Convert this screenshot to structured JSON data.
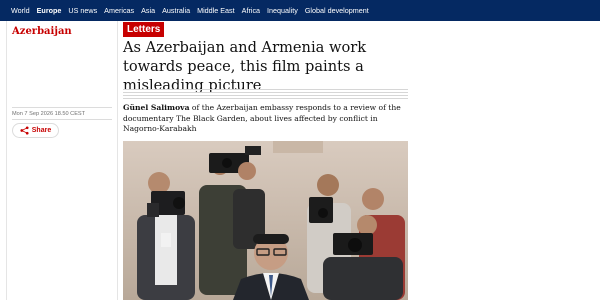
{
  "nav": {
    "items": [
      {
        "label": "World",
        "active": false
      },
      {
        "label": "Europe",
        "active": true
      },
      {
        "label": "US news",
        "active": false
      },
      {
        "label": "Americas",
        "active": false
      },
      {
        "label": "Asia",
        "active": false
      },
      {
        "label": "Australia",
        "active": false
      },
      {
        "label": "Middle East",
        "active": false
      },
      {
        "label": "Africa",
        "active": false
      },
      {
        "label": "Inequality",
        "active": false
      },
      {
        "label": "Global development",
        "active": false
      }
    ]
  },
  "article": {
    "section": "Azerbaijan",
    "kicker": "Letters",
    "headline": "As Azerbaijan and Armenia work towards peace, this film paints a misleading picture",
    "author": "Günel Salimova",
    "standfirst_rest": " of the Azerbaijan embassy responds to a review of the documentary The Black Garden, about lives affected by conflict in Nagorno-Karabakh",
    "dateline": "Mon 7 Sep 2026 18.50 CEST",
    "share_label": "Share"
  },
  "colors": {
    "nav_bg": "#052962",
    "accent": "#c70000",
    "text": "#121212"
  },
  "icons": {
    "share": "share-icon"
  }
}
